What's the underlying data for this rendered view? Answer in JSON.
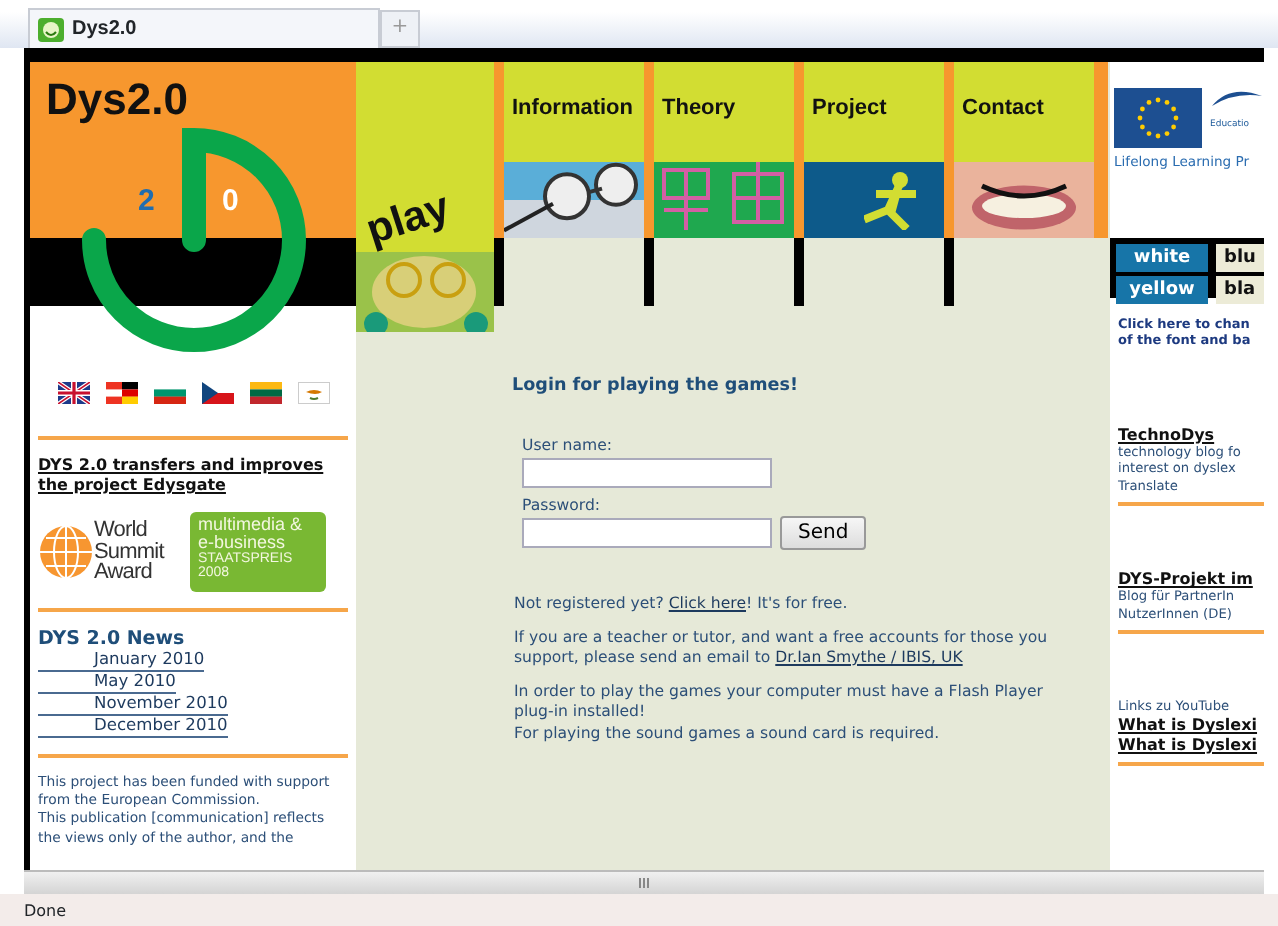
{
  "browser": {
    "tab_title": "Dys2.0",
    "new_tab": "+",
    "status": "Done"
  },
  "logo": {
    "title": "Dys2.0",
    "digits": [
      "2",
      "0"
    ]
  },
  "play": "play",
  "nav": [
    {
      "label": "Information",
      "kind": "picture"
    },
    {
      "label": "Theory",
      "kind": "picture"
    },
    {
      "label": "Project",
      "kind": "icon"
    },
    {
      "label": "Contact",
      "kind": "picture"
    }
  ],
  "eu": {
    "caption": "Educatio",
    "program": "Lifelong Learning Pr"
  },
  "theme_buttons": [
    {
      "label": "white",
      "kind": "dark"
    },
    {
      "label": "blu",
      "kind": "light"
    },
    {
      "label": "yellow",
      "kind": "dark"
    },
    {
      "label": "bla",
      "kind": "light"
    }
  ],
  "theme_hint": "Click here to chan\nof the font and ba",
  "left": {
    "headline": "DYS 2.0 transfers and improves the project Edysgate",
    "award_1": "World Summit Award",
    "award_2": [
      "multimedia &",
      "e-business",
      "STAATSPREIS 2008"
    ],
    "news_title": "DYS 2.0 News",
    "news": [
      "January 2010",
      "May 2010",
      "November 2010",
      "December 2010"
    ],
    "funding": "This project has been funded with support from the European Commission.\nThis publication [communication] reflects the views only of the author, and the"
  },
  "login": {
    "title": "Login for playing the games!",
    "fields": [
      {
        "label": "User name:"
      },
      {
        "label": "Password:"
      }
    ],
    "submit": "Send",
    "paragraphs": [
      [
        {
          "text": "Not registered yet? "
        },
        {
          "link": "Click here"
        },
        {
          "text": "! It's for free."
        }
      ],
      [
        {
          "text": "If you are a teacher or tutor, and want a free accounts for those you support, please send an email to "
        },
        {
          "link": "Dr.Ian Smythe / IBIS, UK"
        }
      ],
      [
        {
          "text": "In order to play the games your computer must have a Flash Player\nplug-in installed!\nFor playing the sound games a sound card is required."
        }
      ]
    ]
  },
  "right": {
    "blogs": [
      {
        "title": "TechnoDys",
        "text": "technology blog fo\ninterest on dyslex\nTranslate"
      },
      {
        "title": "DYS-Projekt im",
        "text": "Blog für PartnerIn\nNutzerInnen (DE)"
      }
    ],
    "youtube_intro": "Links zu YouTube",
    "youtube_links": [
      "What is Dyslexi",
      "What is Dyslexi"
    ]
  }
}
